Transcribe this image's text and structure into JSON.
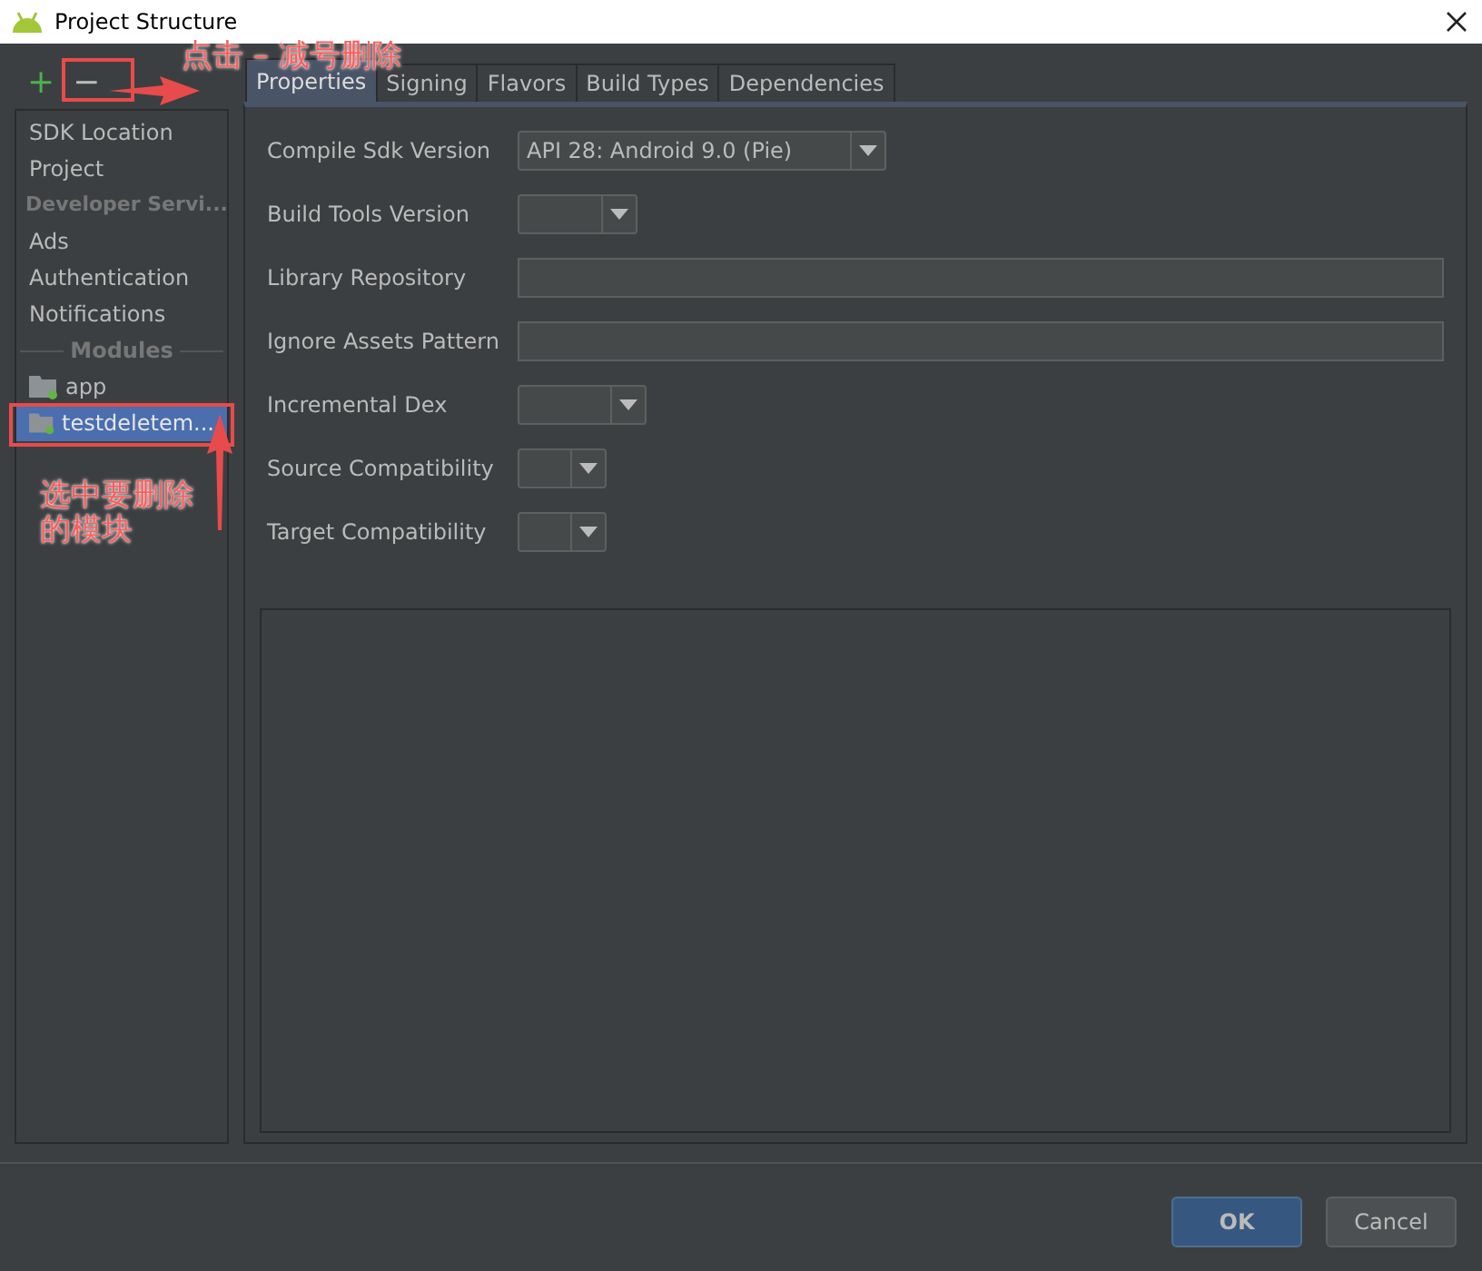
{
  "window": {
    "title": "Project Structure"
  },
  "toolbar": {
    "add": "+",
    "remove": "−"
  },
  "sidebar": {
    "items": [
      {
        "kind": "item",
        "label": "SDK Location",
        "selected": false
      },
      {
        "kind": "item",
        "label": "Project",
        "selected": false
      },
      {
        "kind": "header",
        "label": "Developer Servi..."
      },
      {
        "kind": "item",
        "label": "Ads",
        "selected": false
      },
      {
        "kind": "item",
        "label": "Authentication",
        "selected": false
      },
      {
        "kind": "item",
        "label": "Notifications",
        "selected": false
      },
      {
        "kind": "divider",
        "label": "Modules"
      },
      {
        "kind": "module",
        "label": "app",
        "selected": false
      },
      {
        "kind": "module",
        "label": "testdeletem...",
        "selected": true
      }
    ]
  },
  "tabs": [
    {
      "label": "Properties",
      "selected": true
    },
    {
      "label": "Signing",
      "selected": false
    },
    {
      "label": "Flavors",
      "selected": false
    },
    {
      "label": "Build Types",
      "selected": false
    },
    {
      "label": "Dependencies",
      "selected": false
    }
  ],
  "properties": [
    {
      "label": "Compile Sdk Version",
      "kind": "combo",
      "value": "API 28: Android 9.0 (Pie)"
    },
    {
      "label": "Build Tools Version",
      "kind": "combo"
    },
    {
      "label": "Library Repository",
      "kind": "text"
    },
    {
      "label": "Ignore Assets Pattern",
      "kind": "text"
    },
    {
      "label": "Incremental Dex",
      "kind": "combo"
    },
    {
      "label": "Source Compatibility",
      "kind": "combo"
    },
    {
      "label": "Target Compatibility",
      "kind": "combo"
    }
  ],
  "buttons": [
    {
      "label": "OK",
      "kind": "default"
    },
    {
      "label": "Cancel",
      "kind": "normal"
    }
  ],
  "annotations": [
    {
      "text": "点击 – 减号删除"
    },
    {
      "text": "选中要删除的模块"
    }
  ]
}
